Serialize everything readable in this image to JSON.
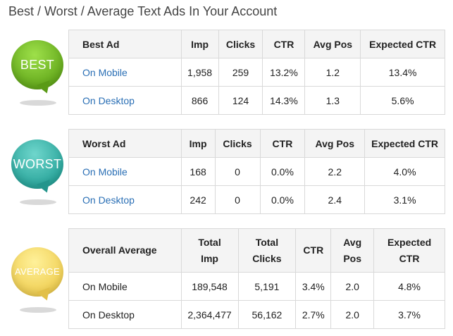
{
  "page_title": "Best / Worst / Average Text Ads In Your Account",
  "colors": {
    "best": "#6cb31f",
    "worst": "#2fa99f",
    "average": "#f0cf54",
    "link": "#2a6fb5"
  },
  "best": {
    "badge": "BEST",
    "headers": [
      "Best Ad",
      "Imp",
      "Clicks",
      "CTR",
      "Avg Pos",
      "Expected CTR"
    ],
    "rows": [
      [
        "On Mobile",
        "1,958",
        "259",
        "13.2%",
        "1.2",
        "13.4%"
      ],
      [
        "On Desktop",
        "866",
        "124",
        "14.3%",
        "1.3",
        "5.6%"
      ]
    ]
  },
  "worst": {
    "badge": "WORST",
    "headers": [
      "Worst Ad",
      "Imp",
      "Clicks",
      "CTR",
      "Avg Pos",
      "Expected CTR"
    ],
    "rows": [
      [
        "On Mobile",
        "168",
        "0",
        "0.0%",
        "2.2",
        "4.0%"
      ],
      [
        "On Desktop",
        "242",
        "0",
        "0.0%",
        "2.4",
        "3.1%"
      ]
    ]
  },
  "average": {
    "badge": "AVERAGE",
    "headers": [
      [
        "Overall Average"
      ],
      [
        "Total",
        "Imp"
      ],
      [
        "Total",
        "Clicks"
      ],
      [
        "CTR"
      ],
      [
        "Avg",
        "Pos"
      ],
      [
        "Expected",
        "CTR"
      ]
    ],
    "rows": [
      [
        "On Mobile",
        "189,548",
        "5,191",
        "3.4%",
        "2.0",
        "4.8%"
      ],
      [
        "On Desktop",
        "2,364,477",
        "56,162",
        "2.7%",
        "2.0",
        "3.7%"
      ]
    ]
  }
}
